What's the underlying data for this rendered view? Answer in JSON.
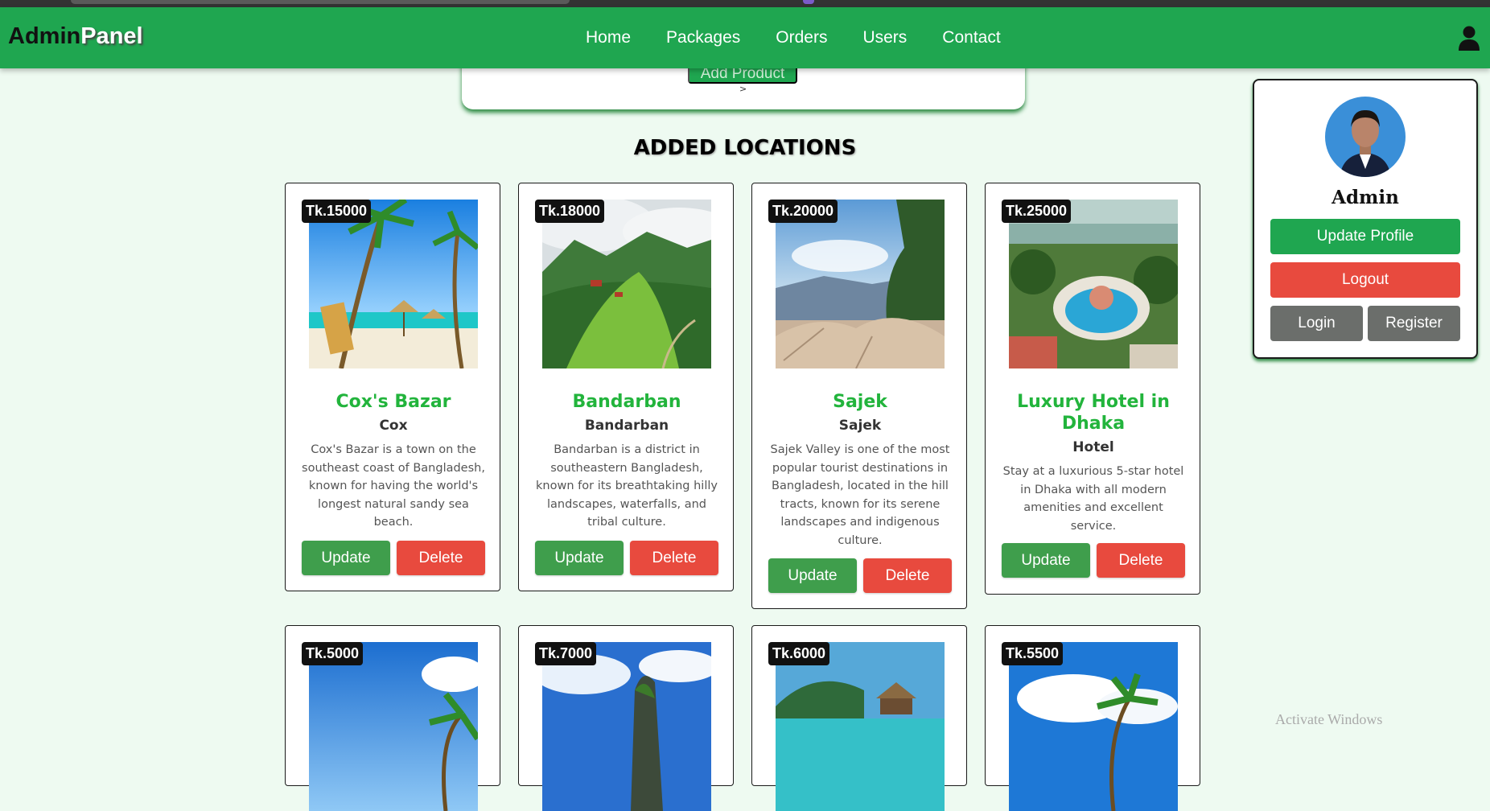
{
  "brand": {
    "part1": "Admin",
    "part2": "Panel"
  },
  "nav": {
    "home": "Home",
    "packages": "Packages",
    "orders": "Orders",
    "users": "Users",
    "contact": "Contact"
  },
  "form": {
    "add_product": "Add Product",
    "caret": ">"
  },
  "section_title": "ADDED LOCATIONS",
  "cards": [
    {
      "price": "Tk.15000",
      "title": "Cox's Bazar",
      "subtitle": "Cox",
      "description": "Cox's Bazar is a town on the southeast coast of Bangladesh, known for having the world's longest natural sandy sea beach.",
      "update": "Update",
      "delete": "Delete"
    },
    {
      "price": "Tk.18000",
      "title": "Bandarban",
      "subtitle": "Bandarban",
      "description": "Bandarban is a district in southeastern Bangladesh, known for its breathtaking hilly landscapes, waterfalls, and tribal culture.",
      "update": "Update",
      "delete": "Delete"
    },
    {
      "price": "Tk.20000",
      "title": "Sajek",
      "subtitle": "Sajek",
      "description": "Sajek Valley is one of the most popular tourist destinations in Bangladesh, located in the hill tracts, known for its serene landscapes and indigenous culture.",
      "update": "Update",
      "delete": "Delete"
    },
    {
      "price": "Tk.25000",
      "title": "Luxury Hotel in Dhaka",
      "subtitle": "Hotel",
      "description": "Stay at a luxurious 5-star hotel in Dhaka with all modern amenities and excellent service.",
      "update": "Update",
      "delete": "Delete"
    },
    {
      "price": "Tk.5000"
    },
    {
      "price": "Tk.7000"
    },
    {
      "price": "Tk.6000"
    },
    {
      "price": "Tk.5500"
    }
  ],
  "profile": {
    "name": "Admin",
    "update_profile": "Update Profile",
    "logout": "Logout",
    "login": "Login",
    "register": "Register"
  },
  "watermark": "Activate Windows",
  "colors": {
    "navbar": "#1fa650",
    "accent_title": "#22b43c",
    "update_btn": "#3f9e4c",
    "delete_btn": "#e84a3e",
    "page_bg": "#eefaf1"
  }
}
